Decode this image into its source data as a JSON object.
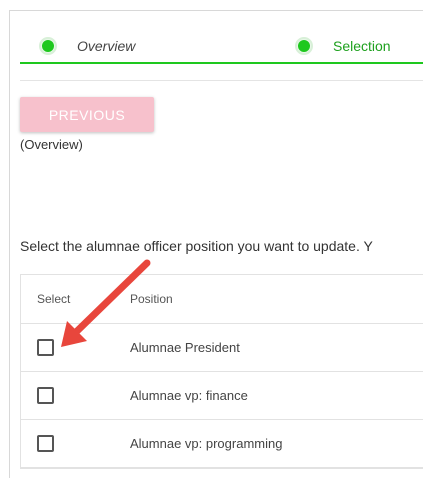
{
  "stepper": {
    "steps": [
      {
        "label": "Overview"
      },
      {
        "label": "Selection"
      }
    ]
  },
  "previous_button": {
    "label": "PREVIOUS",
    "sub_label": "(Overview)"
  },
  "instruction": "Select the alumnae officer position you want to update. Y",
  "table": {
    "headers": {
      "select": "Select",
      "position": "Position"
    },
    "rows": [
      {
        "position": "Alumnae President",
        "checked": false
      },
      {
        "position": "Alumnae vp: finance",
        "checked": false
      },
      {
        "position": "Alumnae vp: programming",
        "checked": false
      }
    ]
  },
  "colors": {
    "accent_green": "#1ec81e",
    "button_pink": "#f7c1cc",
    "arrow_red": "#e8463c"
  }
}
